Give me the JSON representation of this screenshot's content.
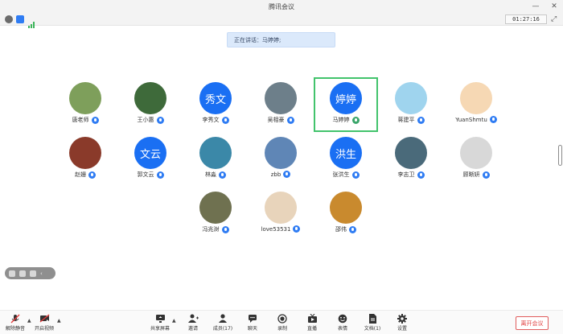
{
  "window": {
    "title": "腾讯会议"
  },
  "status": {
    "timer": "01:27:16"
  },
  "speaking_banner": "正在讲话：马婷婷;",
  "participants": [
    {
      "name": "唐老师",
      "avatar_text": "",
      "avatar_color": "#7e9f5b"
    },
    {
      "name": "王小惠",
      "avatar_text": "",
      "avatar_color": "#3e6a3a"
    },
    {
      "name": "李秀文",
      "avatar_text": "秀文",
      "avatar_color": "#1a6ff3"
    },
    {
      "name": "吴相豪",
      "avatar_text": "",
      "avatar_color": "#6d7f8a"
    },
    {
      "name": "马婷婷",
      "avatar_text": "婷婷",
      "avatar_color": "#1a6ff3"
    },
    {
      "name": "蒋建平",
      "avatar_text": "",
      "avatar_color": "#9fd4ee"
    },
    {
      "name": "YuanShmtu",
      "avatar_text": "",
      "avatar_color": "#f6d8b4"
    },
    {
      "name": "赵姗",
      "avatar_text": "",
      "avatar_color": "#8a3a2a"
    },
    {
      "name": "郭文云",
      "avatar_text": "文云",
      "avatar_color": "#1a6ff3"
    },
    {
      "name": "林淼",
      "avatar_text": "",
      "avatar_color": "#3b88a8"
    },
    {
      "name": "zbb",
      "avatar_text": "",
      "avatar_color": "#5f86b6"
    },
    {
      "name": "张洪生",
      "avatar_text": "洪生",
      "avatar_color": "#1a6ff3"
    },
    {
      "name": "李志卫",
      "avatar_text": "",
      "avatar_color": "#4a6a7a"
    },
    {
      "name": "顾晰妍",
      "avatar_text": "",
      "avatar_color": "#d8d8d8"
    },
    {
      "name": "冯兆澍",
      "avatar_text": "",
      "avatar_color": "#6f7150"
    },
    {
      "name": "love53531",
      "avatar_text": "",
      "avatar_color": "#e8d4bb"
    },
    {
      "name": "邵伟",
      "avatar_text": "",
      "avatar_color": "#c98a2e"
    }
  ],
  "toolbar": {
    "unmute": "解除静音",
    "start_video": "开启视频",
    "share_screen": "共享屏幕",
    "invite": "邀请",
    "members": "成员(17)",
    "chat": "聊天",
    "record": "录制",
    "live": "直播",
    "reactions": "表情",
    "docs": "文档(1)",
    "settings": "设置",
    "leave": "离开会议"
  }
}
